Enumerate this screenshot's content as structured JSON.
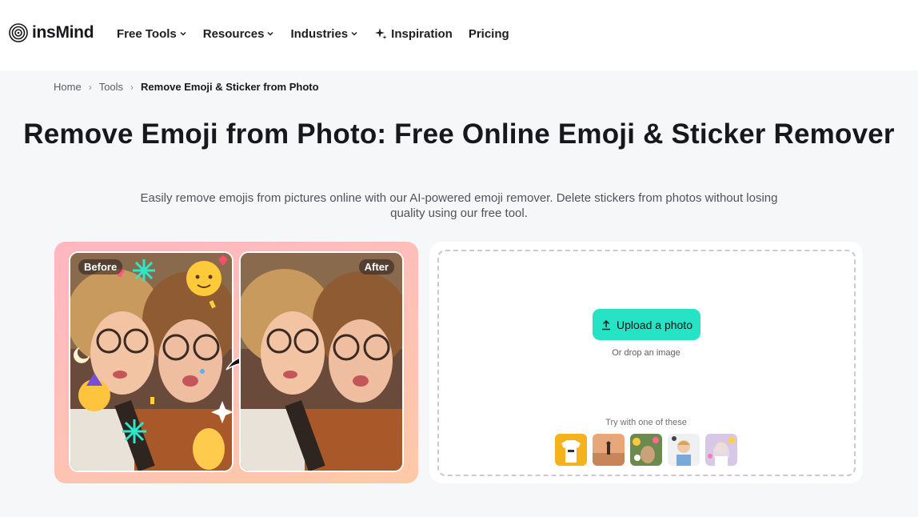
{
  "header": {
    "logo_text": "insMind",
    "nav": [
      {
        "label": "Free Tools",
        "dropdown": true
      },
      {
        "label": "Resources",
        "dropdown": true
      },
      {
        "label": "Industries",
        "dropdown": true
      },
      {
        "label": "Inspiration",
        "dropdown": false,
        "icon": "sparkle-icon"
      },
      {
        "label": "Pricing",
        "dropdown": false
      }
    ]
  },
  "breadcrumb": {
    "items": [
      "Home",
      "Tools"
    ],
    "current": "Remove Emoji & Sticker from Photo"
  },
  "hero": {
    "title": "Remove Emoji from Photo: Free Online Emoji & Sticker Remover",
    "subtitle": "Easily remove emojis from pictures online with our AI-powered emoji remover. Delete stickers from photos without losing quality using our free tool."
  },
  "comparison": {
    "before_label": "Before",
    "after_label": "After"
  },
  "upload": {
    "button_label": "Upload a photo",
    "drop_hint": "Or drop an image",
    "try_label": "Try with one of these",
    "samples": [
      "sample-tshirt",
      "sample-beach-person",
      "sample-dog-stickers",
      "sample-child",
      "sample-girl-stickers"
    ]
  },
  "colors": {
    "accent": "#25e3c4",
    "panel_gradient_start": "#ffb6c1",
    "panel_gradient_end": "#ffc9a6",
    "page_bg": "#f6f7f9"
  }
}
